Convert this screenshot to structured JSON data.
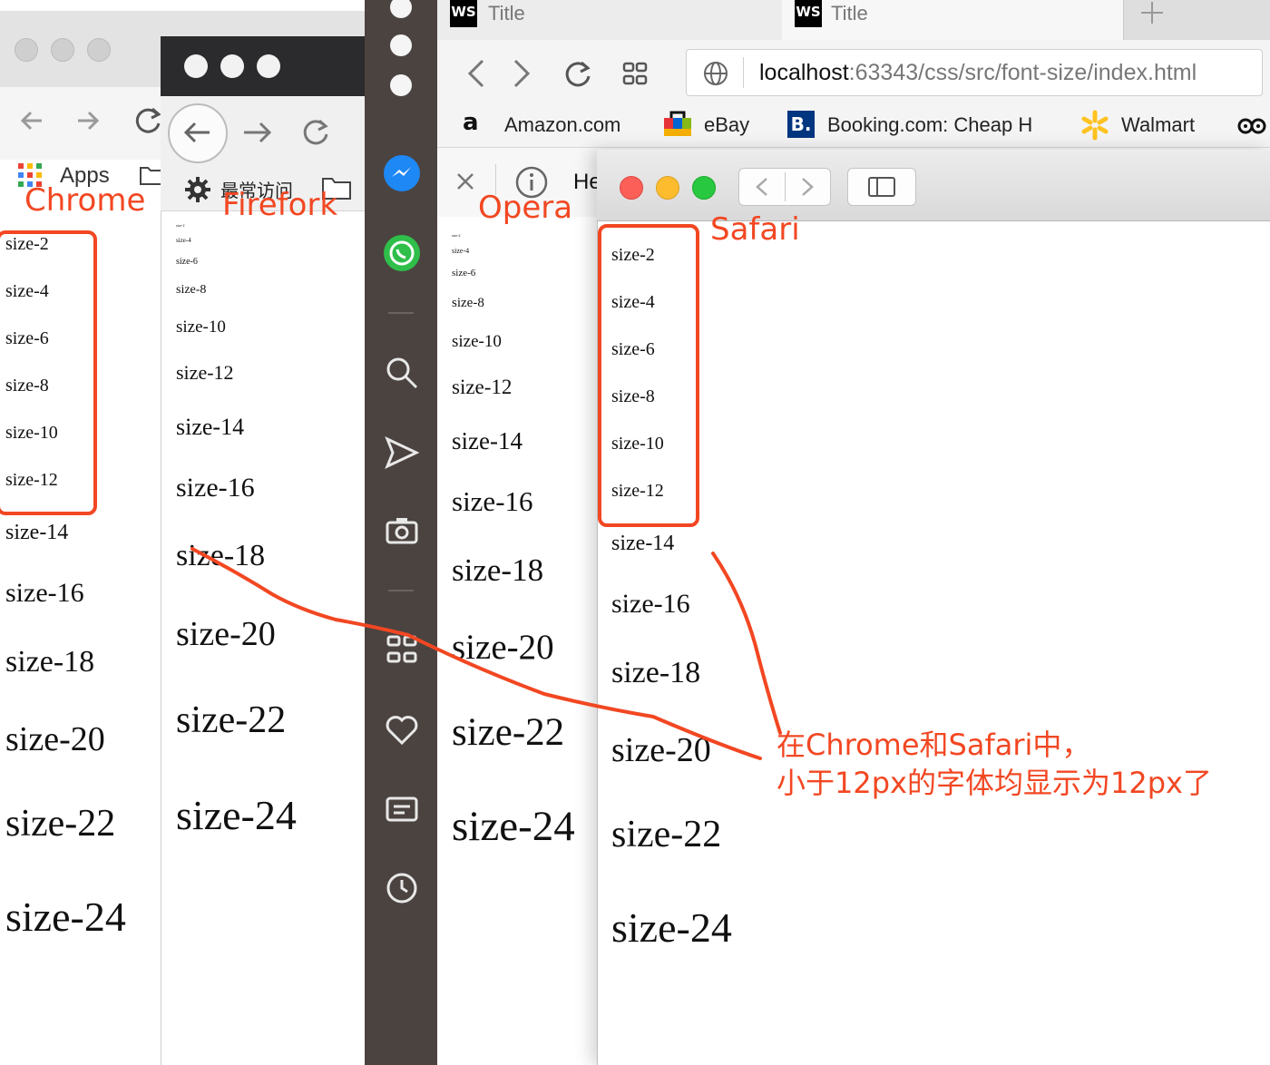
{
  "chrome": {
    "bookmark_apps": "Apps",
    "label": "Chrome",
    "sizes": [
      "size-2",
      "size-4",
      "size-6",
      "size-8",
      "size-10",
      "size-12",
      "size-14",
      "size-16",
      "size-18",
      "size-20",
      "size-22",
      "size-24"
    ]
  },
  "firefox": {
    "bookmark_frequent": "最常访问",
    "label": "Firefork",
    "sizes": [
      "size-2",
      "size-4",
      "size-6",
      "size-8",
      "size-10",
      "size-12",
      "size-14",
      "size-16",
      "size-18",
      "size-20",
      "size-22",
      "size-24"
    ]
  },
  "opera": {
    "tabs": [
      {
        "label": "Title"
      },
      {
        "label": "Title"
      }
    ],
    "url_host": "localhost",
    "url_path": ":63343/css/src/font-size/index.html",
    "bookmarks": [
      "Amazon.com",
      "eBay",
      "Booking.com: Cheap H",
      "Walmart"
    ],
    "findbar_text": "He",
    "label": "Opera",
    "sizes": [
      "size-2",
      "size-4",
      "size-6",
      "size-8",
      "size-10",
      "size-12",
      "size-14",
      "size-16",
      "size-18",
      "size-20",
      "size-22",
      "size-24"
    ]
  },
  "safari": {
    "label": "Safari",
    "sizes": [
      "size-2",
      "size-4",
      "size-6",
      "size-8",
      "size-10",
      "size-12",
      "size-14",
      "size-16",
      "size-18",
      "size-20",
      "size-22",
      "size-24"
    ]
  },
  "annotation": {
    "line1": "在Chrome和Safari中，",
    "line2": "小于12px的字体均显示为12px了",
    "color": "#f24722"
  }
}
